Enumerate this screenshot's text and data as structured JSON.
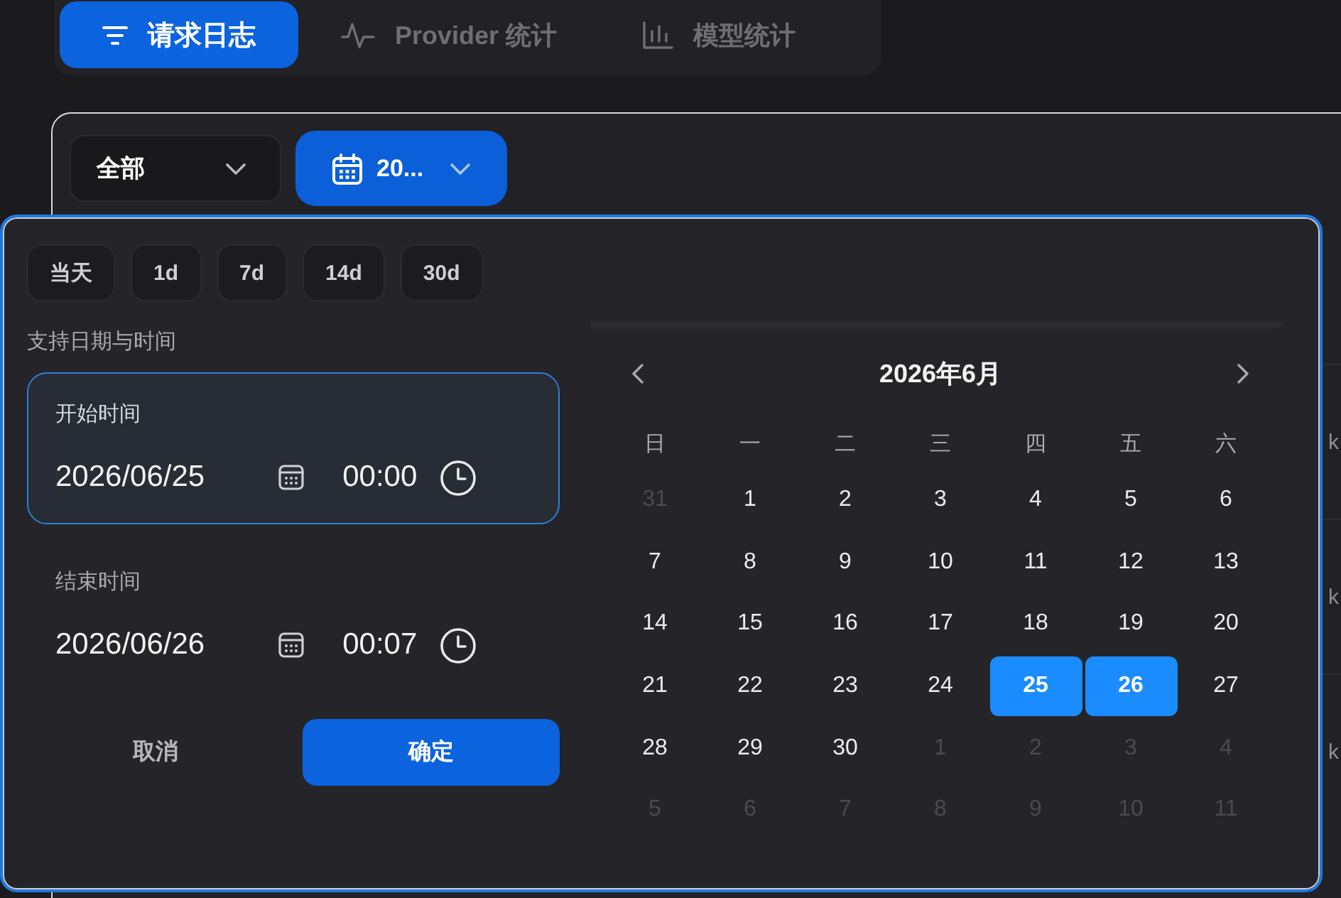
{
  "tabs": [
    {
      "label": "请求日志",
      "selected": true
    },
    {
      "label": "Provider 统计",
      "selected": false
    },
    {
      "label": "模型统计",
      "selected": false
    }
  ],
  "filters": {
    "scope_select": {
      "value": "全部"
    },
    "date_range_button": {
      "label": "20..."
    }
  },
  "date_picker": {
    "presets": [
      "当天",
      "1d",
      "7d",
      "14d",
      "30d"
    ],
    "hint": "支持日期与时间",
    "start": {
      "label": "开始时间",
      "date": "2026/06/25",
      "time": "00:00",
      "selected": true
    },
    "end": {
      "label": "结束时间",
      "date": "2026/06/26",
      "time": "00:07",
      "selected": false
    },
    "buttons": [
      {
        "label": "取消",
        "kind": "secondary"
      },
      {
        "label": "确定",
        "kind": "primary"
      }
    ],
    "calendar": {
      "title": "2026年6月",
      "weekdays": [
        "日",
        "一",
        "二",
        "三",
        "四",
        "五",
        "六"
      ],
      "weeks": [
        [
          {
            "day": "31",
            "in_month": false,
            "selected": false
          },
          {
            "day": "1",
            "in_month": true,
            "selected": false
          },
          {
            "day": "2",
            "in_month": true,
            "selected": false
          },
          {
            "day": "3",
            "in_month": true,
            "selected": false
          },
          {
            "day": "4",
            "in_month": true,
            "selected": false
          },
          {
            "day": "5",
            "in_month": true,
            "selected": false
          },
          {
            "day": "6",
            "in_month": true,
            "selected": false
          }
        ],
        [
          {
            "day": "7",
            "in_month": true,
            "selected": false
          },
          {
            "day": "8",
            "in_month": true,
            "selected": false
          },
          {
            "day": "9",
            "in_month": true,
            "selected": false
          },
          {
            "day": "10",
            "in_month": true,
            "selected": false
          },
          {
            "day": "11",
            "in_month": true,
            "selected": false
          },
          {
            "day": "12",
            "in_month": true,
            "selected": false
          },
          {
            "day": "13",
            "in_month": true,
            "selected": false
          }
        ],
        [
          {
            "day": "14",
            "in_month": true,
            "selected": false
          },
          {
            "day": "15",
            "in_month": true,
            "selected": false
          },
          {
            "day": "16",
            "in_month": true,
            "selected": false
          },
          {
            "day": "17",
            "in_month": true,
            "selected": false
          },
          {
            "day": "18",
            "in_month": true,
            "selected": false
          },
          {
            "day": "19",
            "in_month": true,
            "selected": false
          },
          {
            "day": "20",
            "in_month": true,
            "selected": false
          }
        ],
        [
          {
            "day": "21",
            "in_month": true,
            "selected": false
          },
          {
            "day": "22",
            "in_month": true,
            "selected": false
          },
          {
            "day": "23",
            "in_month": true,
            "selected": false
          },
          {
            "day": "24",
            "in_month": true,
            "selected": false
          },
          {
            "day": "25",
            "in_month": true,
            "selected": true
          },
          {
            "day": "26",
            "in_month": true,
            "selected": true
          },
          {
            "day": "27",
            "in_month": true,
            "selected": false
          }
        ],
        [
          {
            "day": "28",
            "in_month": true,
            "selected": false
          },
          {
            "day": "29",
            "in_month": true,
            "selected": false
          },
          {
            "day": "30",
            "in_month": true,
            "selected": false
          },
          {
            "day": "1",
            "in_month": false,
            "selected": false
          },
          {
            "day": "2",
            "in_month": false,
            "selected": false
          },
          {
            "day": "3",
            "in_month": false,
            "selected": false
          },
          {
            "day": "4",
            "in_month": false,
            "selected": false
          }
        ],
        [
          {
            "day": "5",
            "in_month": false,
            "selected": false
          },
          {
            "day": "6",
            "in_month": false,
            "selected": false
          },
          {
            "day": "7",
            "in_month": false,
            "selected": false
          },
          {
            "day": "8",
            "in_month": false,
            "selected": false
          },
          {
            "day": "9",
            "in_month": false,
            "selected": false
          },
          {
            "day": "10",
            "in_month": false,
            "selected": false
          },
          {
            "day": "11",
            "in_month": false,
            "selected": false
          }
        ]
      ]
    }
  },
  "table": {
    "rows": [
      {
        "column_1": "k"
      },
      {
        "column_1": "k"
      },
      {
        "column_1": "k"
      }
    ]
  }
}
